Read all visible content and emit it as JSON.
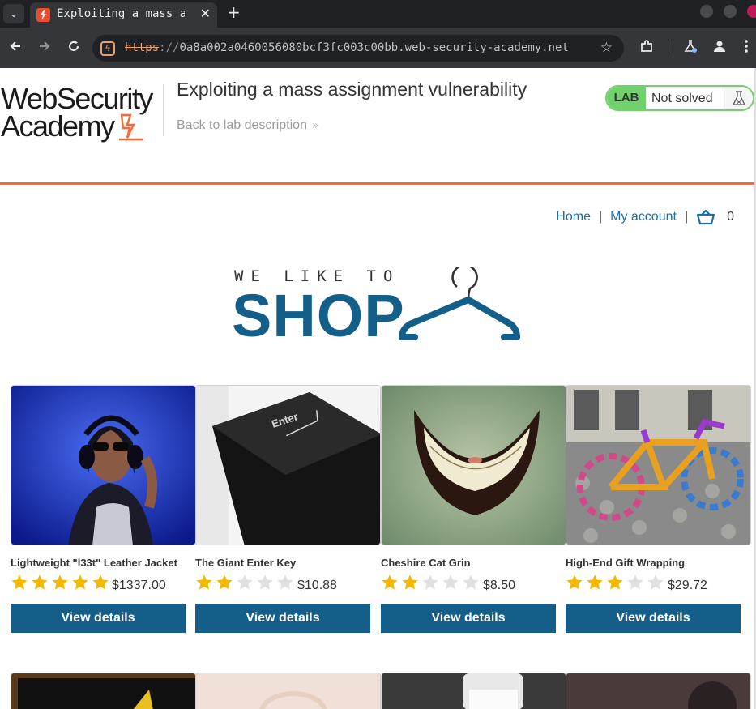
{
  "browser": {
    "tab_title": "Exploiting a mass assignment vulnerability",
    "tab_close_glyph": "✕",
    "new_tab_glyph": "+",
    "tab_menu_glyph": "⌄",
    "url_protocol": "https",
    "url_separator": "://",
    "url_rest": "0a8a002a0460056080bcf3fc003c00bb.web-security-academy.net",
    "icons": [
      "back-icon",
      "forward-icon",
      "reload-icon",
      "site-info-icon",
      "bookmark-star-icon",
      "extensions-icon",
      "labs-icon",
      "profile-icon",
      "menu-icon"
    ]
  },
  "lab_header": {
    "logo_line1": "WebSecurity",
    "logo_line2": "Academy",
    "title": "Exploiting a mass assignment vulnerability",
    "back_link": "Back to lab description",
    "back_chevron": "»",
    "status_badge": "LAB",
    "status_text": "Not solved",
    "status_color": "#70d16d"
  },
  "shop_nav": {
    "home": "Home",
    "separator": "|",
    "my_account": "My account",
    "cart_count": "0"
  },
  "hero": {
    "small_text": "WE LIKE TO",
    "big_text": "SHOP"
  },
  "colors": {
    "accent_orange": "#ff6633",
    "brand_blue": "#135f8a",
    "link_blue": "#1d6fa5",
    "star_gold": "#f5b800",
    "star_grey": "#e0e0e0"
  },
  "products": [
    {
      "name": "Lightweight \"l33t\" Leather Jacket",
      "price": "$1337.00",
      "rating": 5,
      "button": "View details"
    },
    {
      "name": "The Giant Enter Key",
      "price": "$10.88",
      "rating": 2,
      "button": "View details"
    },
    {
      "name": "Cheshire Cat Grin",
      "price": "$8.50",
      "rating": 2,
      "button": "View details"
    },
    {
      "name": "High-End Gift Wrapping",
      "price": "$29.72",
      "rating": 3,
      "button": "View details"
    }
  ]
}
